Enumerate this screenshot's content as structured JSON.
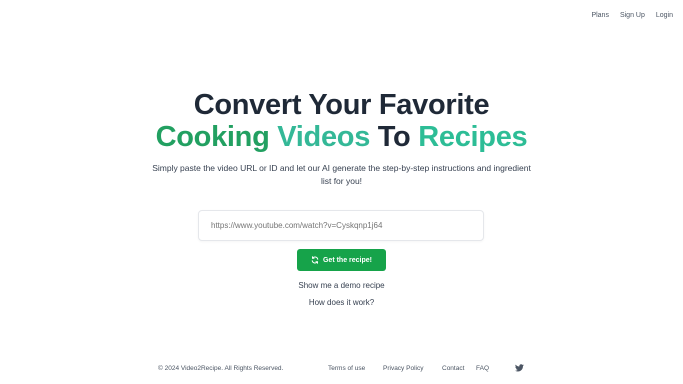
{
  "nav": {
    "plans": "Plans",
    "signup": "Sign Up",
    "login": "Login"
  },
  "hero": {
    "line1": "Convert Your Favorite",
    "word_cooking": "Cooking",
    "word_videos": "Videos",
    "word_to": "To",
    "word_recipes": "Recipes",
    "subtitle": "Simply paste the video URL or ID and let our AI generate the step-by-step instructions and ingredient list for you!"
  },
  "search": {
    "placeholder": "https://www.youtube.com/watch?v=Cyskqnp1j64"
  },
  "cta": {
    "label": "Get the recipe!",
    "icon": "refresh-icon"
  },
  "links": {
    "demo": "Show me a demo recipe",
    "how": "How does it work?"
  },
  "footer": {
    "copyright": "© 2024 Video2Recipe. All Rights Reserved.",
    "terms": "Terms of use",
    "privacy": "Privacy Policy",
    "contact": "Contact",
    "faq": "FAQ",
    "social_icon": "twitter-icon"
  },
  "colors": {
    "dark_text": "#1f2937",
    "green_primary": "#16a34a",
    "green_teal": "#34b897"
  }
}
